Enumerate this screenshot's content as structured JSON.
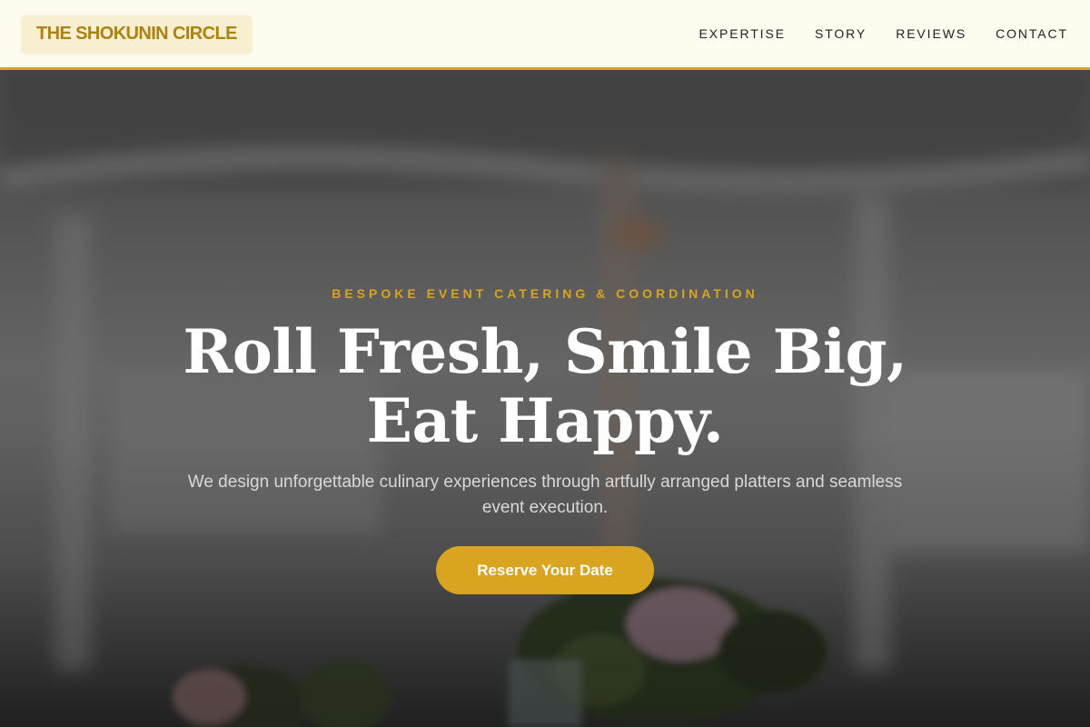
{
  "brand": {
    "name": "THE SHOKUNIN CIRCLE"
  },
  "nav": {
    "items": [
      {
        "label": "EXPERTISE"
      },
      {
        "label": "STORY"
      },
      {
        "label": "REVIEWS"
      },
      {
        "label": "CONTACT"
      }
    ]
  },
  "hero": {
    "eyebrow": "BESPOKE EVENT CATERING & COORDINATION",
    "headline": "Roll Fresh, Smile Big, Eat Happy.",
    "subtext": "We design unforgettable culinary experiences through artfully arranged platters and seamless event execution.",
    "cta_label": "Reserve Your Date"
  },
  "colors": {
    "accent": "#d9a521",
    "header_bg": "#fefcee",
    "logo_text": "#ac8310"
  }
}
